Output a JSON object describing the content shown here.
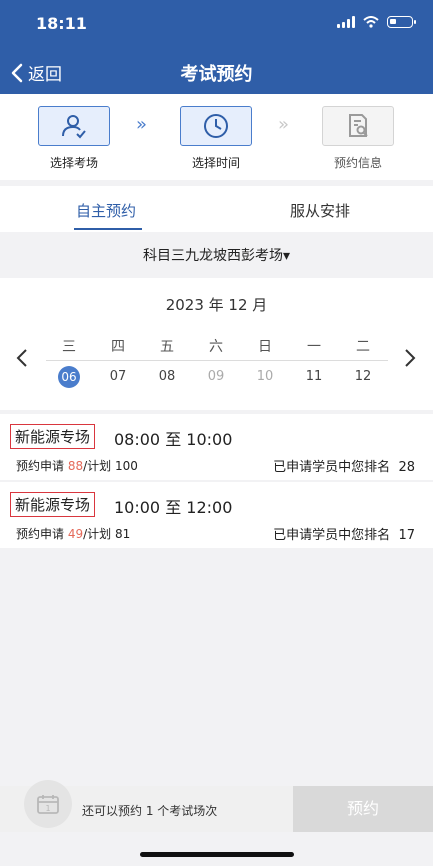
{
  "status_bar": {
    "time": "18:11"
  },
  "nav": {
    "back_label": "返回",
    "title": "考试预约"
  },
  "steps": [
    {
      "label": "选择考场",
      "icon": "person-check-icon",
      "state": "active"
    },
    {
      "label": "选择时间",
      "icon": "clock-icon",
      "state": "active"
    },
    {
      "label": "预约信息",
      "icon": "document-search-icon",
      "state": "inactive"
    }
  ],
  "tabs": [
    {
      "label": "自主预约",
      "selected": true
    },
    {
      "label": "服从安排",
      "selected": false
    }
  ],
  "venue": {
    "label": "科目三九龙坡西彭考场▾"
  },
  "calendar": {
    "month": "2023 年 12 月",
    "weekdays": [
      "三",
      "四",
      "五",
      "六",
      "日",
      "一",
      "二"
    ],
    "dates": [
      "06",
      "07",
      "08",
      "09",
      "10",
      "11",
      "12"
    ],
    "selected_index": 0,
    "dim_indexes": [
      3,
      4
    ]
  },
  "sessions": [
    {
      "name": "新能源专场",
      "time": "08:00 至 10:00",
      "apply_prefix": "预约申请 ",
      "applied": "88",
      "plan": "/计划 100",
      "rank_label": "已申请学员中您排名",
      "rank": "28"
    },
    {
      "name": "新能源专场",
      "time": "10:00 至 12:00",
      "apply_prefix": "预约申请 ",
      "applied": "49",
      "plan": "/计划 81",
      "rank_label": "已申请学员中您排名",
      "rank": "17"
    }
  ],
  "footer": {
    "remaining_text": "还可以预约 1 个考试场次",
    "reserve_label": "预约"
  },
  "colors": {
    "header": "#2f5ea8",
    "accent": "#4a7dcc",
    "highlight_border": "#d9363e",
    "applied_number": "#e46a5a"
  }
}
